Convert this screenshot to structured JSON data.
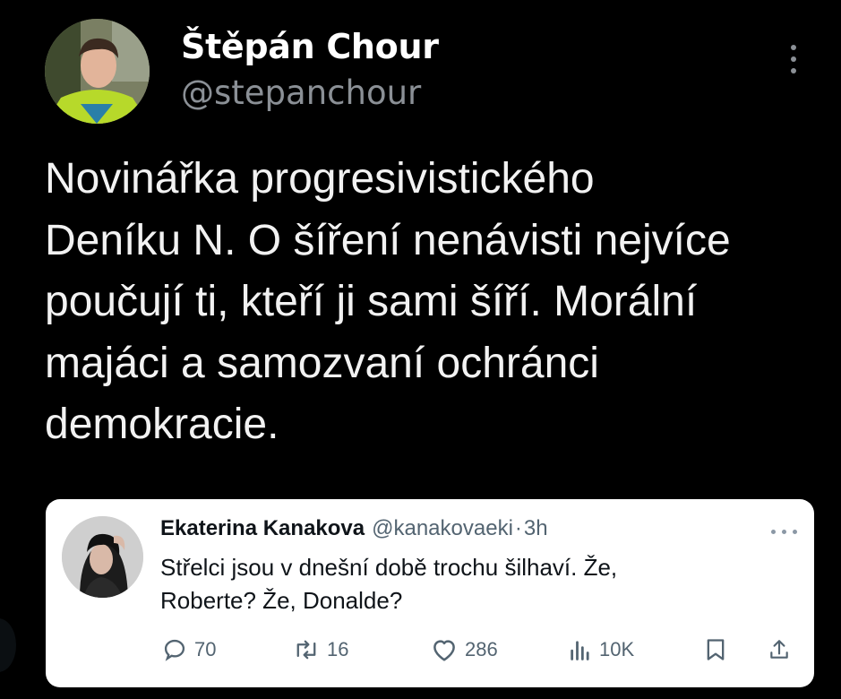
{
  "tweet": {
    "author_name": "Štěpán Chour",
    "author_handle": "@stepanchour",
    "text": "Novinářka progresivistického\nDeníku N. O šíření nenávisti nejvíce\npoučují ti, kteří ji sami šíří. Morální\nmajáci a samozvaní ochránci\ndemokracie.",
    "menu_icon": "more-vertical-icon"
  },
  "quoted_tweet": {
    "author_name": "Ekaterina Kanakova",
    "author_handle": "@kanakovaeki",
    "separator": "·",
    "time": "3h",
    "text": "Střelci jsou v dnešní době trochu šilhaví. Že,\nRoberte? Že, Donalde?",
    "menu_icon": "more-horizontal-icon",
    "actions": {
      "reply": {
        "icon": "reply-icon",
        "count": "70"
      },
      "retweet": {
        "icon": "retweet-icon",
        "count": "16"
      },
      "like": {
        "icon": "heart-icon",
        "count": "286"
      },
      "views": {
        "icon": "views-icon",
        "count": "10K"
      },
      "bookmark": {
        "icon": "bookmark-icon"
      },
      "share": {
        "icon": "share-icon"
      }
    }
  },
  "colors": {
    "background": "#000000",
    "primary_text": "#e7e9ea",
    "secondary_text": "#8b9096",
    "card_background": "#ffffff",
    "card_text": "#0f1419",
    "card_secondary": "#536471"
  }
}
